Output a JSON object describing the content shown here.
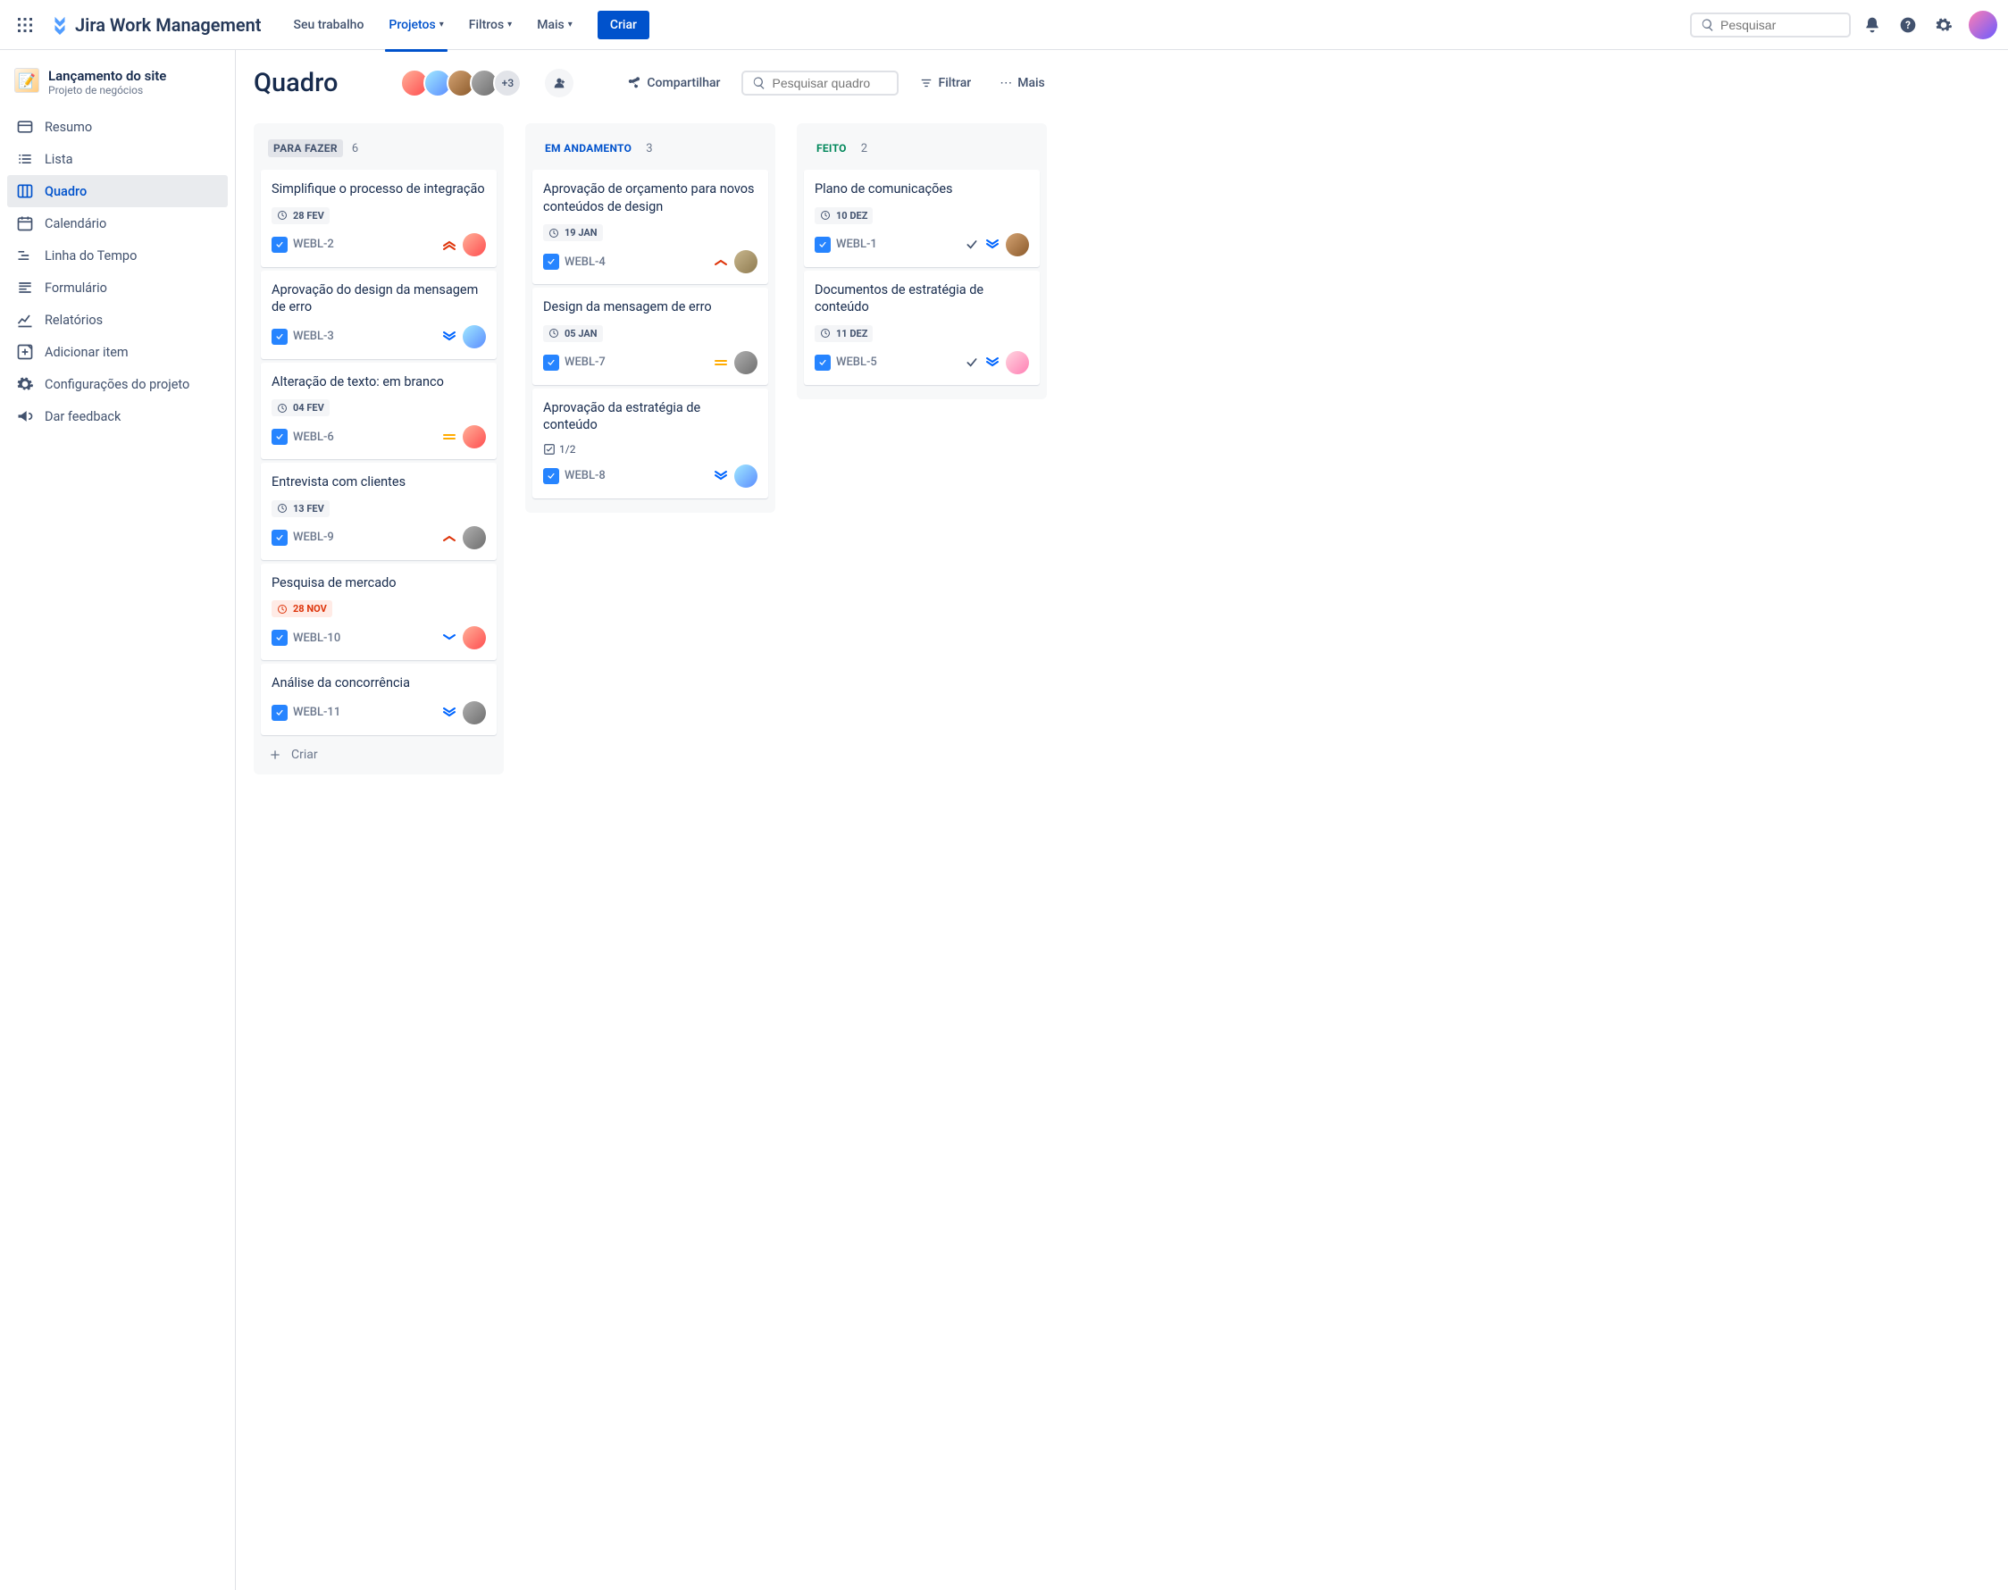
{
  "app": {
    "name": "Jira Work Management"
  },
  "nav": {
    "your_work": "Seu trabalho",
    "projects": "Projetos",
    "filters": "Filtros",
    "more": "Mais",
    "create": "Criar"
  },
  "search": {
    "global_placeholder": "Pesquisar",
    "board_placeholder": "Pesquisar quadro"
  },
  "project": {
    "name": "Lançamento do site",
    "type": "Projeto de negócios"
  },
  "sidebar": {
    "items": [
      {
        "label": "Resumo",
        "icon": "summary"
      },
      {
        "label": "Lista",
        "icon": "list"
      },
      {
        "label": "Quadro",
        "icon": "board",
        "active": true
      },
      {
        "label": "Calendário",
        "icon": "calendar"
      },
      {
        "label": "Linha do Tempo",
        "icon": "timeline"
      },
      {
        "label": "Formulário",
        "icon": "form"
      },
      {
        "label": "Relatórios",
        "icon": "reports"
      },
      {
        "label": "Adicionar item",
        "icon": "add"
      },
      {
        "label": "Configurações do projeto",
        "icon": "settings"
      },
      {
        "label": "Dar feedback",
        "icon": "feedback"
      }
    ]
  },
  "board": {
    "title": "Quadro",
    "avatar_more": "+3",
    "share": "Compartilhar",
    "filter": "Filtrar",
    "more": "Mais",
    "create_card": "Criar"
  },
  "columns": [
    {
      "title": "PARA FAZER",
      "count": "6",
      "style": "todo",
      "cards": [
        {
          "title": "Simplifique o processo de integração",
          "date": "28 FEV",
          "key": "WEBL-2",
          "priority": "highest",
          "avatar": "a1"
        },
        {
          "title": "Aprovação do design da mensagem de erro",
          "key": "WEBL-3",
          "priority": "lowest",
          "avatar": "a2"
        },
        {
          "title": "Alteração de texto: em branco",
          "date": "04 FEV",
          "key": "WEBL-6",
          "priority": "medium",
          "avatar": "a1"
        },
        {
          "title": "Entrevista com clientes",
          "date": "13 FEV",
          "key": "WEBL-9",
          "priority": "high",
          "avatar": "a4"
        },
        {
          "title": "Pesquisa de mercado",
          "date": "28 NOV",
          "overdue": true,
          "key": "WEBL-10",
          "priority": "low",
          "avatar": "a1"
        },
        {
          "title": "Análise da concorrência",
          "key": "WEBL-11",
          "priority": "lowest",
          "avatar": "a4"
        }
      ]
    },
    {
      "title": "EM ANDAMENTO",
      "count": "3",
      "style": "prog",
      "cards": [
        {
          "title": "Aprovação de orçamento para novos conteúdos de design",
          "date": "19 JAN",
          "key": "WEBL-4",
          "priority": "high",
          "avatar": "a6"
        },
        {
          "title": "Design da mensagem de erro",
          "date": "05 JAN",
          "key": "WEBL-7",
          "priority": "medium",
          "avatar": "a4"
        },
        {
          "title": "Aprovação da estratégia de conteúdo",
          "subtasks": "1/2",
          "key": "WEBL-8",
          "priority": "lowest",
          "avatar": "a2"
        }
      ]
    },
    {
      "title": "FEITO",
      "count": "2",
      "style": "done",
      "cards": [
        {
          "title": "Plano de comunicações",
          "date": "10 DEZ",
          "key": "WEBL-1",
          "priority": "lowest",
          "done": true,
          "avatar": "a3"
        },
        {
          "title": "Documentos de estratégia de conteúdo",
          "date": "11 DEZ",
          "key": "WEBL-5",
          "priority": "lowest",
          "done": true,
          "avatar": "a7"
        }
      ]
    }
  ]
}
